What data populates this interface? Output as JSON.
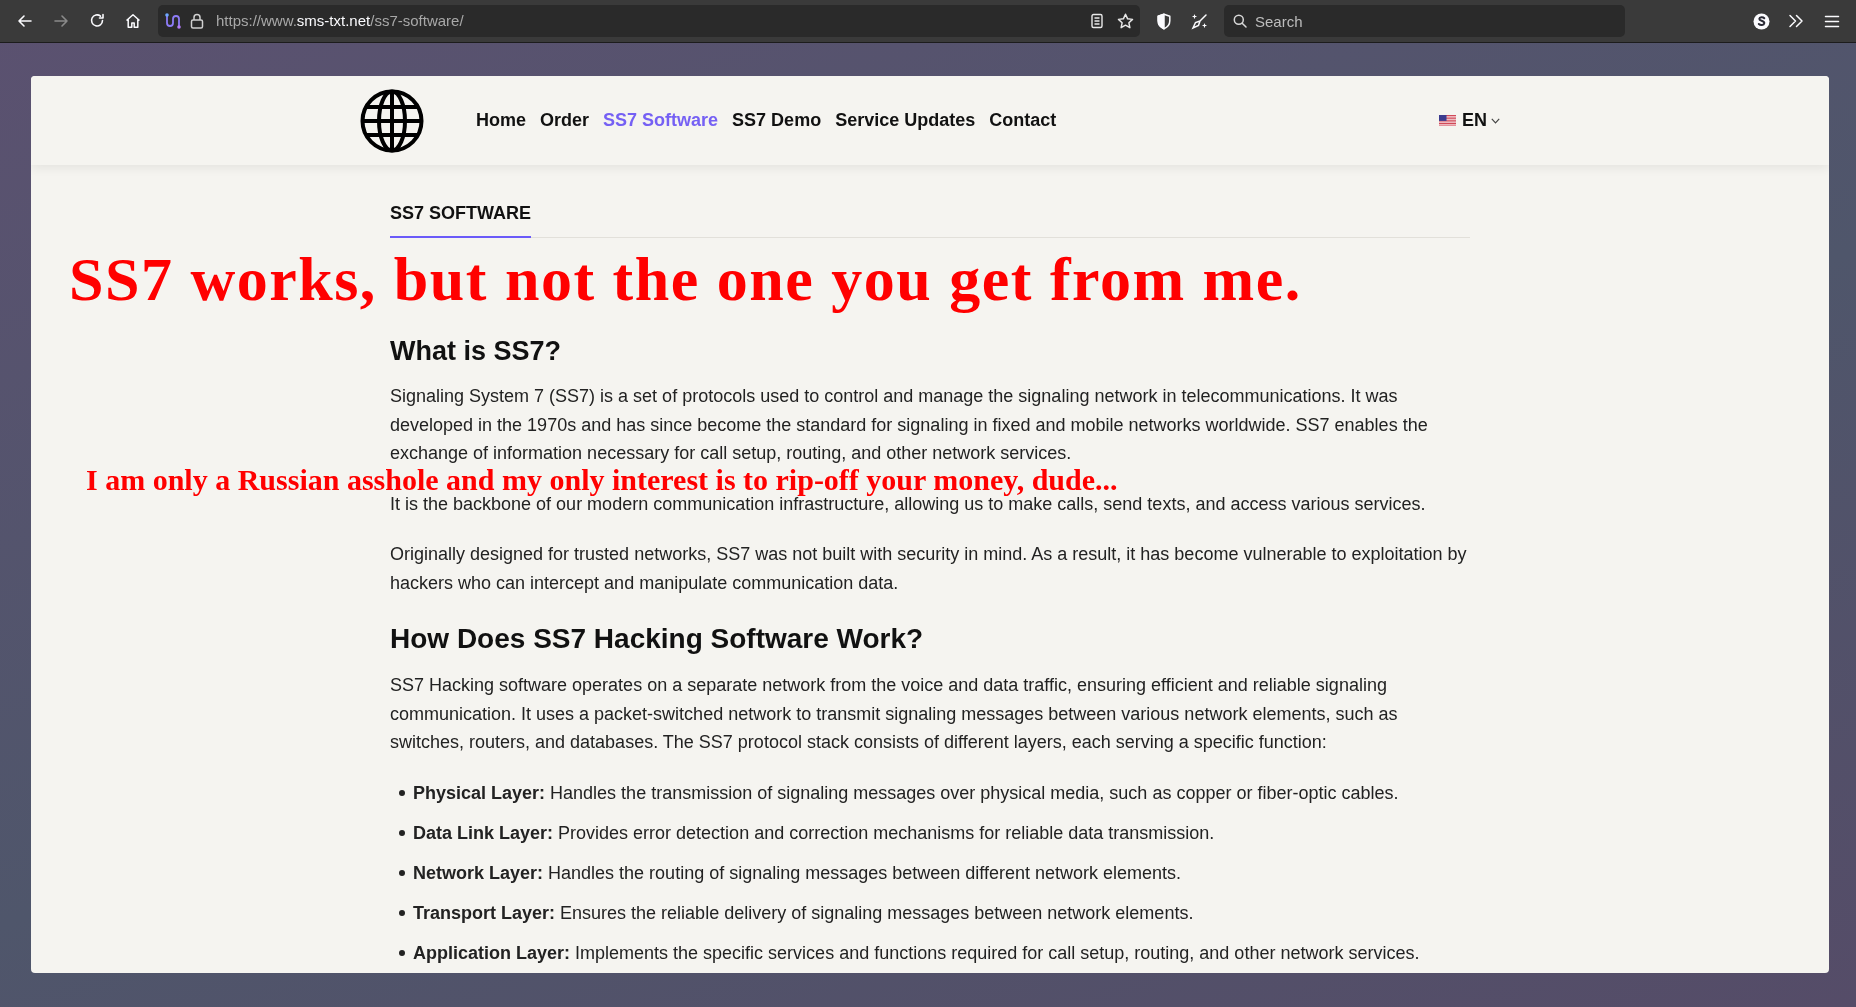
{
  "browser": {
    "back": {
      "disabled": false
    },
    "forward": {
      "disabled": true
    },
    "address_bar": {
      "url": {
        "prefix": "https://www.",
        "domain": "sms-txt.net",
        "path": "/ss7-software/"
      }
    },
    "search_bar": {
      "placeholder": "Search"
    }
  },
  "site": {
    "nav": [
      {
        "label": "Home",
        "selected": false
      },
      {
        "label": "Order",
        "selected": false
      },
      {
        "label": "SS7 Software",
        "selected": true
      },
      {
        "label": "SS7 Demo",
        "selected": false
      },
      {
        "label": "Service Updates",
        "selected": false
      },
      {
        "label": "Contact",
        "selected": false
      }
    ],
    "language": {
      "label": "EN"
    }
  },
  "page_tab": {
    "label": "SS7 SOFTWARE",
    "selected": true
  },
  "sections": [
    {
      "heading": "What is SS7?",
      "paragraphs": [
        "Signaling System 7 (SS7) is a set of protocols used to control and manage the signaling network in telecommunications. It was developed in the 1970s and has since become the standard for signaling in fixed and mobile networks worldwide. SS7 enables the exchange of information necessary for call setup, routing, and other network services.",
        "It is the backbone of our modern communication infrastructure, allowing us to make calls, send texts, and access various services.",
        "Originally designed for trusted networks, SS7 was not built with security in mind. As a result, it has become vulnerable to exploitation by hackers who can intercept and manipulate communication data."
      ]
    },
    {
      "heading": "How Does SS7 Hacking Software Work?",
      "paragraphs": [
        "SS7 Hacking software operates on a separate network from the voice and data traffic, ensuring efficient and reliable signaling communication. It uses a packet-switched network to transmit signaling messages between various network elements, such as switches, routers, and databases. The SS7 protocol stack consists of different layers, each serving a specific function:"
      ],
      "list": [
        "**Physical Layer:** Handles the transmission of signaling messages over physical media, such as copper or fiber-optic cables.",
        "**Data Link Layer:** Provides error detection and correction mechanisms for reliable data transmission.",
        "**Network Layer:** Handles the routing of signaling messages between different network elements.",
        "**Transport Layer:** Ensures the reliable delivery of signaling messages between network elements.",
        "**Application Layer:** Implements the specific services and functions required for call setup, routing, and other network services."
      ]
    }
  ],
  "annotations": [
    {
      "kind": "headline",
      "text": "SS7 works, but not the one you get from me."
    },
    {
      "kind": "subline",
      "text": "I am only a Russian asshole and my only interest is to rip-off your money, dude..."
    }
  ]
}
